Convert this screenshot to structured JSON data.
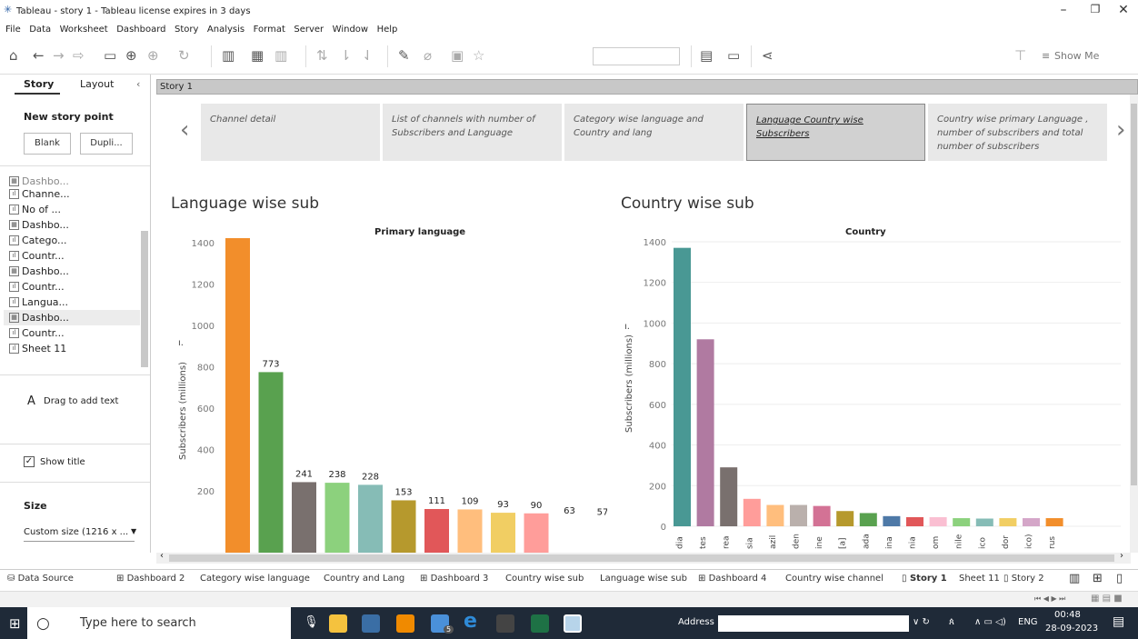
{
  "window": {
    "title": "Tableau - story 1 - Tableau license expires in 3 days"
  },
  "menu": [
    "File",
    "Data",
    "Worksheet",
    "Dashboard",
    "Story",
    "Analysis",
    "Format",
    "Server",
    "Window",
    "Help"
  ],
  "toolbar": {
    "show_me": "Show Me"
  },
  "left_panel": {
    "tabs": [
      "Story",
      "Layout"
    ],
    "new_story_point": "New story point",
    "blank_button": "Blank",
    "duplicate_button": "Dupli...",
    "sheets": [
      "Dashbo...",
      "Channe...",
      "No of ...",
      "Dashbo...",
      "Catego...",
      "Countr...",
      "Dashbo...",
      "Countr...",
      "Langua...",
      "Dashbo...",
      "Countr...",
      "Sheet 11"
    ],
    "drag_text": "Drag to add text",
    "show_title": "Show title",
    "size_label": "Size",
    "size_value": "Custom size (1216 x ..."
  },
  "story": {
    "header": "Story 1",
    "points": [
      "Channel detail",
      "List of channels with number of Subscribers and Language",
      "Category wise language and Country and lang",
      "Language Country wise Subscribers",
      "Country wise primary Language , number of subscribers and total number of subscribers"
    ]
  },
  "chart_data": [
    {
      "type": "bar",
      "title": "Language wise sub",
      "subtitle": "Primary language",
      "ylabel": "Subscribers (millions)",
      "ylim": [
        0,
        1600
      ],
      "yticks": [
        200,
        400,
        600,
        800,
        1000,
        1200,
        1400
      ],
      "values": [
        1450,
        773,
        241,
        238,
        228,
        153,
        111,
        109,
        93,
        90,
        63,
        57
      ],
      "colors": [
        "#f28e2b",
        "#59a14f",
        "#79706e",
        "#8cd17d",
        "#86bcb6",
        "#b6992d",
        "#e15759",
        "#ffbe7d",
        "#f1ce63",
        "#ff9d9a",
        "#ffffff",
        "#ffffff"
      ]
    },
    {
      "type": "bar",
      "title": "Country wise sub",
      "subtitle": "Country",
      "ylabel": "Subscribers (millions)",
      "ylim": [
        0,
        1400
      ],
      "yticks": [
        0,
        200,
        400,
        600,
        800,
        1000,
        1200,
        1400
      ],
      "categories": [
        "dia",
        "tes",
        "rea",
        "sia",
        "azil",
        "den",
        "ine",
        "[a]",
        "ada",
        "ina",
        "nia",
        "om",
        "nile",
        "ico",
        "dor",
        "ico)",
        "rus"
      ],
      "values": [
        1370,
        920,
        290,
        135,
        105,
        105,
        100,
        75,
        65,
        50,
        45,
        45,
        40,
        38,
        40,
        40,
        40
      ],
      "colors": [
        "#499894",
        "#b07aa1",
        "#79706e",
        "#ff9d9a",
        "#ffbe7d",
        "#bab0ac",
        "#d37295",
        "#b6992d",
        "#59a14f",
        "#4e79a7",
        "#e15759",
        "#fabfd2",
        "#8cd17d",
        "#86bcb6",
        "#f1ce63",
        "#d4a6c8",
        "#f28e2b"
      ]
    }
  ],
  "bottom_tabs": [
    "Data Source",
    "Dashboard 2",
    "Category wise language",
    "Country and Lang",
    "Dashboard 3",
    "Country wise sub",
    "Language wise sub",
    "Dashboard 4",
    "Country wise channel",
    "Story 1",
    "Sheet 11",
    "Story 2"
  ],
  "taskbar": {
    "search_placeholder": "Type here to search",
    "address_label": "Address",
    "lang": "ENG",
    "time": "00:48",
    "date": "28-09-2023",
    "badge": "5"
  }
}
